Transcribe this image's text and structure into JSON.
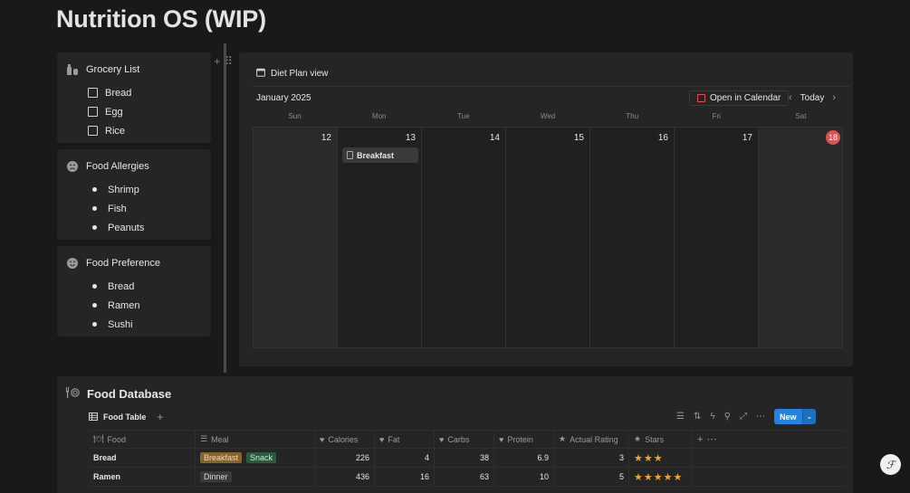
{
  "page": {
    "title": "Nutrition OS (WIP)"
  },
  "cards": [
    {
      "icon": "toiletries-icon",
      "title": "Grocery List",
      "list_type": "checkbox",
      "items": [
        "Bread",
        "Egg",
        "Rice"
      ]
    },
    {
      "icon": "sad-face-icon",
      "title": "Food Allergies",
      "list_type": "bullet",
      "items": [
        "Shrimp",
        "Fish",
        "Peanuts"
      ]
    },
    {
      "icon": "happy-face-icon",
      "title": "Food Preference",
      "list_type": "bullet",
      "items": [
        "Bread",
        "Ramen",
        "Sushi"
      ]
    }
  ],
  "calendar": {
    "view_label": "Diet Plan view",
    "month": "January 2025",
    "open_label": "Open in Calendar",
    "today_label": "Today",
    "weekdays": [
      "Sun",
      "Mon",
      "Tue",
      "Wed",
      "Thu",
      "Fri",
      "Sat"
    ],
    "days": [
      "12",
      "13",
      "14",
      "15",
      "16",
      "17",
      "18"
    ],
    "today_index": 6,
    "events": [
      {
        "day_index": 1,
        "label": "Breakfast"
      }
    ],
    "colors": {
      "today": "#e05050"
    }
  },
  "database": {
    "title": "Food Database",
    "tab_label": "Food Table",
    "new_label": "New",
    "columns": [
      "Food",
      "Meal",
      "Calories",
      "Fat",
      "Carbs",
      "Protein",
      "Actual Rating",
      "Stars"
    ],
    "rows": [
      {
        "food": "Bread",
        "meals": [
          "Breakfast",
          "Snack"
        ],
        "calories": "226",
        "fat": "4",
        "carbs": "38",
        "protein": "6.9",
        "rating": "3",
        "stars": "★★★"
      },
      {
        "food": "Ramen",
        "meals": [
          "Dinner"
        ],
        "calories": "436",
        "fat": "16",
        "carbs": "63",
        "protein": "10",
        "rating": "5",
        "stars": "★★★★★"
      }
    ],
    "meal_colors": {
      "Breakfast": "#89632a",
      "Snack": "#2b5a3d",
      "Dinner": "#3a3a3a"
    },
    "accent": "#2383e2"
  }
}
